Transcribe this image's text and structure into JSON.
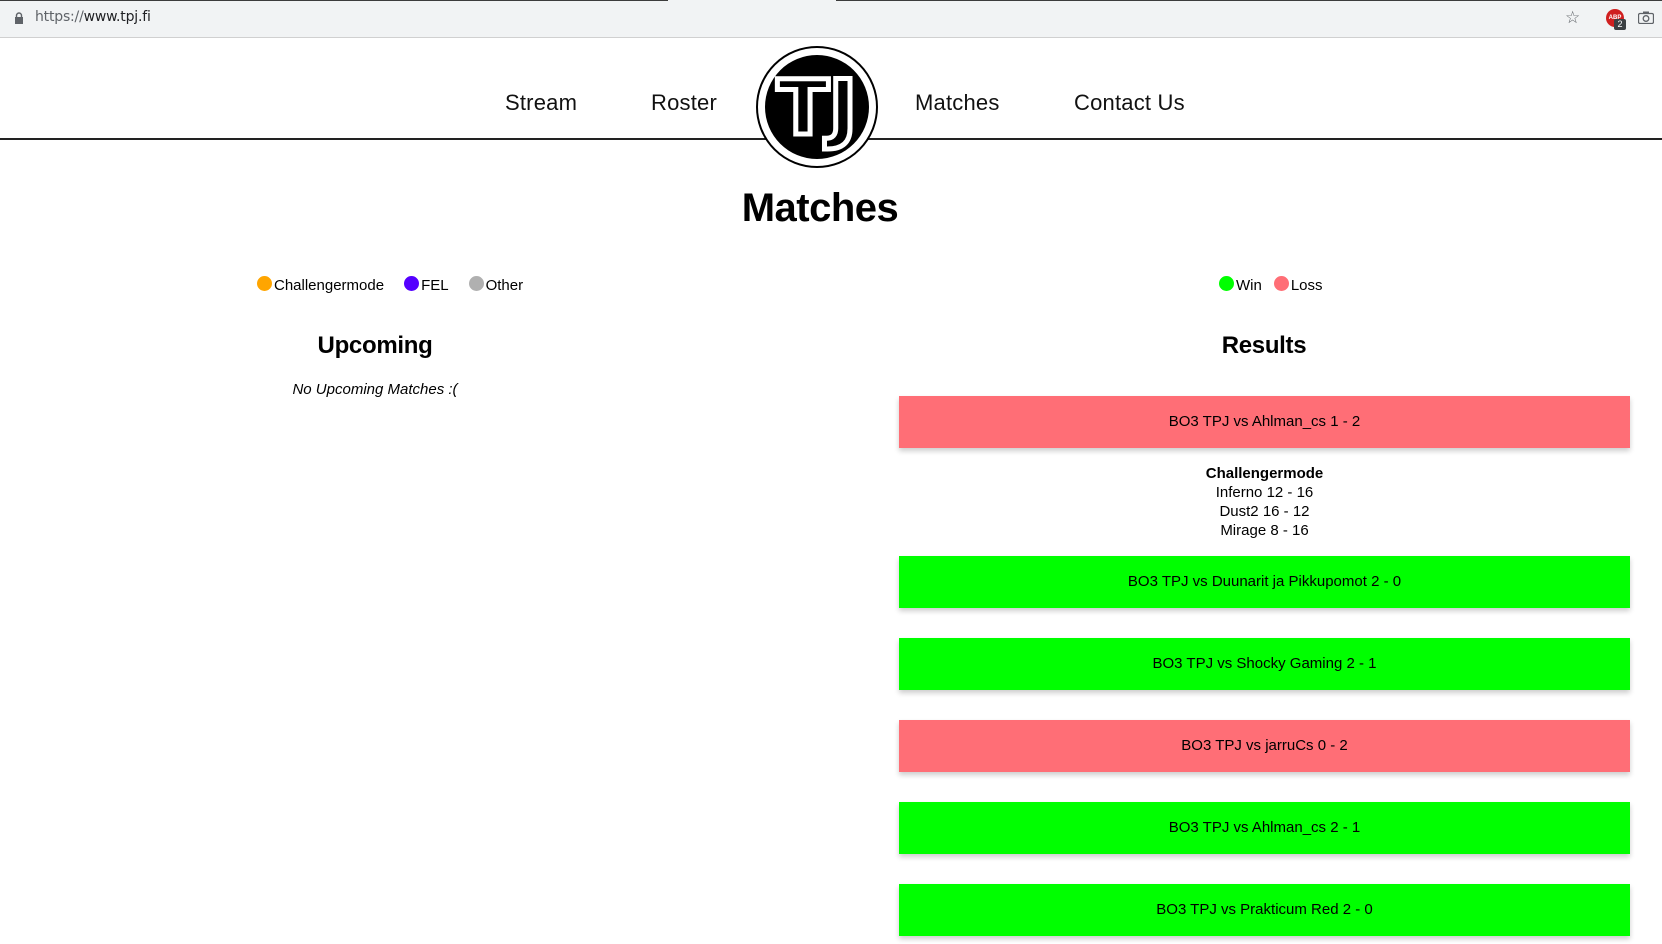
{
  "browser": {
    "url_scheme": "https://",
    "url_host": "www.tpj.fi",
    "abp_label": "ABP",
    "abp_badge": "2",
    "icons": [
      "lock-icon",
      "star-icon",
      "adblock-icon",
      "camera-icon"
    ]
  },
  "nav": {
    "items": [
      {
        "label": "Stream"
      },
      {
        "label": "Roster"
      },
      {
        "label": "Matches"
      },
      {
        "label": "Contact Us"
      }
    ],
    "logo_letters": "TJ"
  },
  "page": {
    "title": "Matches"
  },
  "legend_left": [
    {
      "label": "Challengermode",
      "color": "#ffa500"
    },
    {
      "label": "FEL",
      "color": "#5500ff"
    },
    {
      "label": "Other",
      "color": "#b0b0b0"
    }
  ],
  "legend_right": [
    {
      "label": "Win",
      "color": "#00ff00"
    },
    {
      "label": "Loss",
      "color": "#ff6e76"
    }
  ],
  "upcoming": {
    "title": "Upcoming",
    "empty_text": "No Upcoming Matches :("
  },
  "results": {
    "title": "Results",
    "matches": [
      {
        "label": "BO3 TPJ vs Ahlman_cs 1 - 2",
        "outcome": "loss"
      },
      {
        "label": "BO3 TPJ vs Duunarit ja Pikkupomot 2 - 0",
        "outcome": "win"
      },
      {
        "label": "BO3 TPJ vs Shocky Gaming 2 - 1",
        "outcome": "win"
      },
      {
        "label": "BO3 TPJ vs jarruCs 0 - 2",
        "outcome": "loss"
      },
      {
        "label": "BO3 TPJ vs Ahlman_cs 2 - 1",
        "outcome": "win"
      },
      {
        "label": "BO3 TPJ vs Prakticum Red 2 - 0",
        "outcome": "win"
      }
    ],
    "expanded_details": {
      "league": "Challengermode",
      "maps": [
        "Inferno 12 - 16",
        "Dust2 16 - 12",
        "Mirage 8 - 16"
      ]
    }
  }
}
